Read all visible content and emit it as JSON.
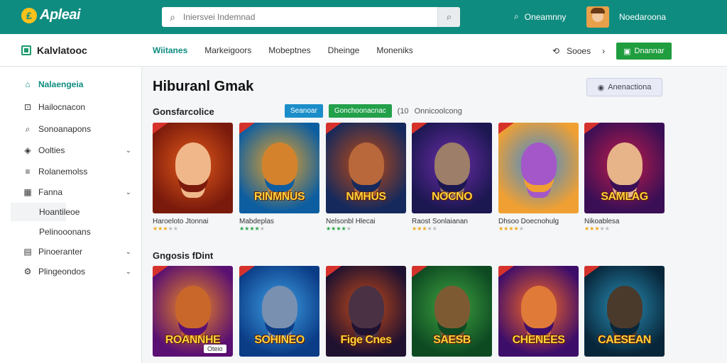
{
  "topbar": {
    "logo_mark": "₤",
    "logo_text": "Apleai",
    "search_placeholder": "Iniersvei Indemnad",
    "community_label": "Oneamnny",
    "user_name": "Noedaroona"
  },
  "navbar": {
    "brand": "Kalvlatooc",
    "tabs": [
      "Wiitanes",
      "Markeigoors",
      "Mobeptnes",
      "Dheinge",
      "Moneniks"
    ],
    "active_tab": 0,
    "saves_label": "Sooes",
    "action_button": "Dnannar"
  },
  "sidebar": {
    "items": [
      {
        "label": "Nalaengeia",
        "icon": "home-icon",
        "glyph": "⌂",
        "active": true,
        "chevron": false
      },
      {
        "label": "Hailocnacon",
        "icon": "book-icon",
        "glyph": "⊡",
        "chevron": false
      },
      {
        "label": "Sonoanapons",
        "icon": "search-icon",
        "glyph": "⌕",
        "chevron": false
      },
      {
        "label": "Oolties",
        "icon": "tag-icon",
        "glyph": "◈",
        "chevron": true
      },
      {
        "label": "Rolanemolss",
        "icon": "list-icon",
        "glyph": "≡",
        "chevron": false
      },
      {
        "label": "Fanna",
        "icon": "grid-icon",
        "glyph": "▦",
        "chevron": true
      },
      {
        "label": "Hoantileoe",
        "sub": true,
        "highlight": true
      },
      {
        "label": "Pelinooonans",
        "sub": true
      },
      {
        "label": "Pinoeranter",
        "icon": "calendar-icon",
        "glyph": "▤",
        "chevron": true
      },
      {
        "label": "Plingeondos",
        "icon": "settings-icon",
        "glyph": "⚙",
        "chevron": true
      }
    ]
  },
  "main": {
    "title": "Hiburanl Gmak",
    "ghost_button": "Anenactiona",
    "section1": "Gonsfarcolice",
    "filter_chips": [
      "Seanoar",
      "Gonchoonacnac"
    ],
    "filter_count": "(10",
    "filter_sort": "Onnicoolcong",
    "section2": "Gngosis fDint",
    "row1": [
      {
        "title": "Haroeloto Jtonnai",
        "rating": 3,
        "stars_color": "orange",
        "bg": [
          "#7a1a0c",
          "#e45a19"
        ],
        "fig": "#f0b88a",
        "cap": ""
      },
      {
        "title": "Mabdeplas",
        "rating": 4,
        "stars_color": "green",
        "bg": [
          "#0d5ea1",
          "#f0a423"
        ],
        "fig": "#d4822c",
        "cap": "RINMNUS"
      },
      {
        "title": "Nelsonbl Hlecai",
        "rating": 4,
        "stars_color": "green",
        "bg": [
          "#15295c",
          "#c24a12"
        ],
        "fig": "#b8683a",
        "cap": "NMHUS"
      },
      {
        "title": "Raost Sonlaianan",
        "rating": 3,
        "stars_color": "orange",
        "bg": [
          "#1b1750",
          "#6b2da8"
        ],
        "fig": "#9d7e68",
        "cap": "NOCNO"
      },
      {
        "title": "Dhsoo Doecnohulg",
        "rating": 4,
        "stars_color": "orange",
        "bg": [
          "#f0a032",
          "#3d8ad6"
        ],
        "fig": "#a457c9",
        "cap": ""
      },
      {
        "title": "Nikoablesa",
        "rating": 3,
        "stars_color": "orange",
        "bg": [
          "#3a0f55",
          "#c01c4b"
        ],
        "fig": "#e7b489",
        "cap": "SAMLAG"
      }
    ],
    "row2": [
      {
        "badge": "Oteio",
        "bg": [
          "#5a1072",
          "#f08a21"
        ],
        "fig": "#c9672a",
        "cap": "ROANNHE"
      },
      {
        "bg": [
          "#0b3c86",
          "#3ea1e8"
        ],
        "fig": "#7a90b0",
        "cap": "SOHINEO"
      },
      {
        "bg": [
          "#1f1130",
          "#c74b19"
        ],
        "fig": "#4a3244",
        "cap": "Fige Cnes"
      },
      {
        "bg": [
          "#0d4a22",
          "#3fa340"
        ],
        "fig": "#7e5a33",
        "cap": "SAESB"
      },
      {
        "bg": [
          "#3d0d6a",
          "#ff6a21"
        ],
        "fig": "#e07a38",
        "cap": "CHENEES"
      },
      {
        "bg": [
          "#07263a",
          "#2b8fb6"
        ],
        "fig": "#4a3a2c",
        "cap": "CAESEAN"
      }
    ]
  }
}
